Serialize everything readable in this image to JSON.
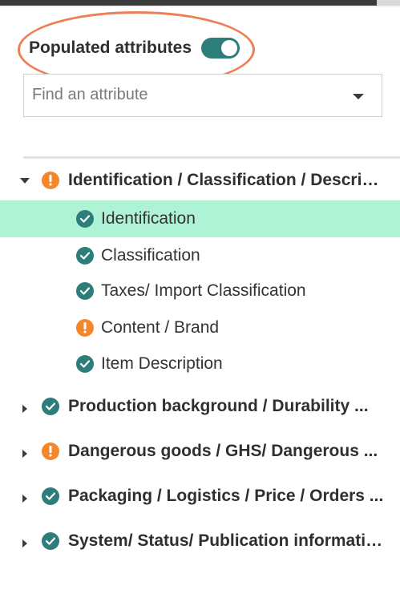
{
  "filter": {
    "populated_label": "Populated attributes",
    "populated_toggle_on": true
  },
  "search": {
    "placeholder": "Find an attribute"
  },
  "tree": {
    "groups": [
      {
        "label": "Identification / Classification / Description",
        "status": "warning",
        "expanded": true,
        "children": [
          {
            "label": "Identification",
            "status": "complete",
            "selected": true
          },
          {
            "label": "Classification",
            "status": "complete"
          },
          {
            "label": "Taxes/ Import Classification",
            "status": "complete"
          },
          {
            "label": "Content / Brand",
            "status": "warning"
          },
          {
            "label": "Item Description",
            "status": "complete"
          }
        ]
      },
      {
        "label": "Production background / Durability ...",
        "status": "complete",
        "expanded": false
      },
      {
        "label": "Dangerous goods / GHS/ Dangerous ...",
        "status": "warning",
        "expanded": false
      },
      {
        "label": "Packaging / Logistics / Price / Orders ...",
        "status": "complete",
        "expanded": false
      },
      {
        "label": "System/ Status/ Publication information ...",
        "status": "complete",
        "expanded": false
      }
    ]
  },
  "colors": {
    "complete": "#2d7d7a",
    "warning": "#f5862a",
    "selected_row": "#aef3d6",
    "annotation": "#ee7f55"
  },
  "icons": {
    "complete": "check-circle-icon",
    "warning": "exclamation-circle-icon",
    "expanded": "caret-down-icon",
    "collapsed": "caret-right-icon"
  }
}
